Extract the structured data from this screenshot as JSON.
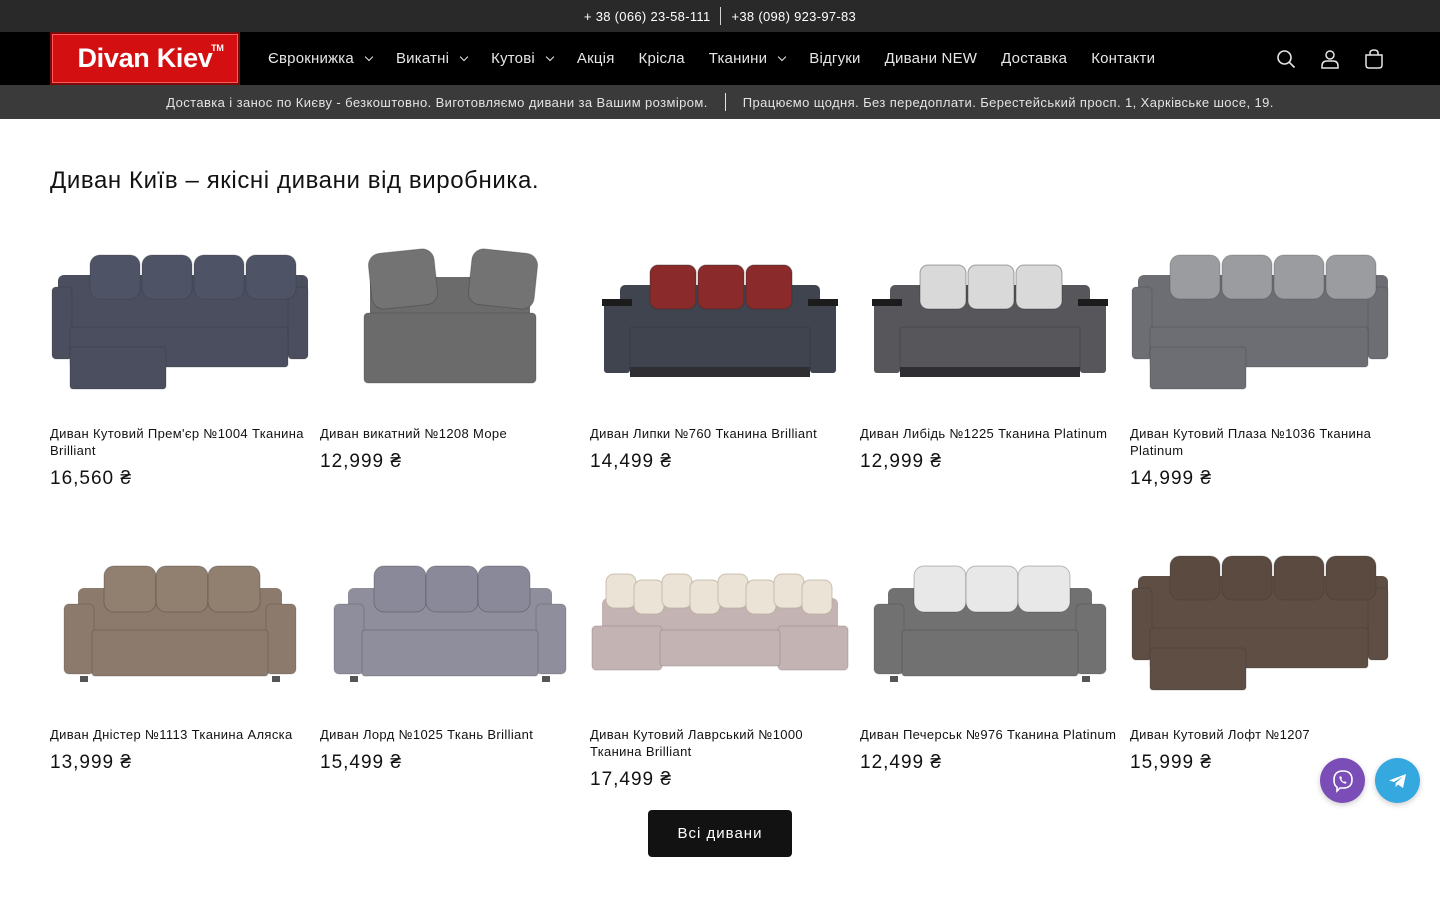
{
  "topbar": {
    "phone1": "+ 38 (066) 23-58-111",
    "phone2": "+38 (098) 923-97-83"
  },
  "header": {
    "logo_text": "Divan Kiev",
    "logo_tm": "TM",
    "nav": [
      {
        "label": "Єврокнижка",
        "has_dropdown": true
      },
      {
        "label": "Викатні",
        "has_dropdown": true
      },
      {
        "label": "Кутові",
        "has_dropdown": true
      },
      {
        "label": "Акція",
        "has_dropdown": false
      },
      {
        "label": "Крісла",
        "has_dropdown": false
      },
      {
        "label": "Тканини",
        "has_dropdown": true
      },
      {
        "label": "Відгуки",
        "has_dropdown": false
      },
      {
        "label": "Дивани NEW",
        "has_dropdown": false
      },
      {
        "label": "Доставка",
        "has_dropdown": false
      },
      {
        "label": "Контакти",
        "has_dropdown": false
      }
    ],
    "icons": [
      "search-icon",
      "account-icon",
      "cart-icon"
    ]
  },
  "announcement": {
    "left": "Доставка і занос по Києву - безкоштовно. Виготовляємо дивани за Вашим розміром.",
    "right": "Працюємо щодня. Без передоплати. Берестейський просп. 1, Харківське шосе, 19."
  },
  "main": {
    "title": "Диван Київ – якісні дивани від виробника.",
    "products": [
      {
        "title": "Диван Кутовий Прем'єр №1004 Тканина Brilliant",
        "price": "16,560 ₴",
        "color": "#4a4e5e",
        "pillow": "#4f5366",
        "kind": "corner"
      },
      {
        "title": "Диван викатний №1208 Море",
        "price": "12,999 ₴",
        "color": "#6b6b6b",
        "pillow": "#737373",
        "kind": "compact"
      },
      {
        "title": "Диван Липки №760 Тканина Brilliant",
        "price": "14,499 ₴",
        "color": "#40444f",
        "pillow": "#8a2a2a",
        "kind": "wood"
      },
      {
        "title": "Диван Либідь №1225 Тканина Platinum",
        "price": "12,999 ₴",
        "color": "#56565b",
        "pillow": "#d9d9d9",
        "kind": "wood"
      },
      {
        "title": "Диван Кутовий Плаза №1036 Тканина Platinum",
        "price": "14,999 ₴",
        "color": "#6c6e73",
        "pillow": "#9a9ca0",
        "kind": "corner"
      },
      {
        "title": "Диван Дністер №1113 Тканина Аляска",
        "price": "13,999 ₴",
        "color": "#8c7b6c",
        "pillow": "#917f70",
        "kind": "straight"
      },
      {
        "title": "Диван Лорд №1025 Ткань Brilliant",
        "price": "15,499 ₴",
        "color": "#8f8e9c",
        "pillow": "#8a899a",
        "kind": "straight"
      },
      {
        "title": "Диван Кутовий Лаврський №1000 Тканина Brilliant",
        "price": "17,499 ₴",
        "color": "#c4b3b3",
        "pillow": "#ebe3d6",
        "kind": "u"
      },
      {
        "title": "Диван Печерськ №976 Тканина Platinum",
        "price": "12,499 ₴",
        "color": "#717171",
        "pillow": "#e8e8e8",
        "kind": "straight"
      },
      {
        "title": "Диван Кутовий Лофт №1207",
        "price": "15,999 ₴",
        "color": "#5e4e44",
        "pillow": "#5b4a40",
        "kind": "corner"
      }
    ],
    "all_button": "Всі дивани"
  },
  "floating": {
    "viber": "viber-icon",
    "telegram": "telegram-icon"
  }
}
